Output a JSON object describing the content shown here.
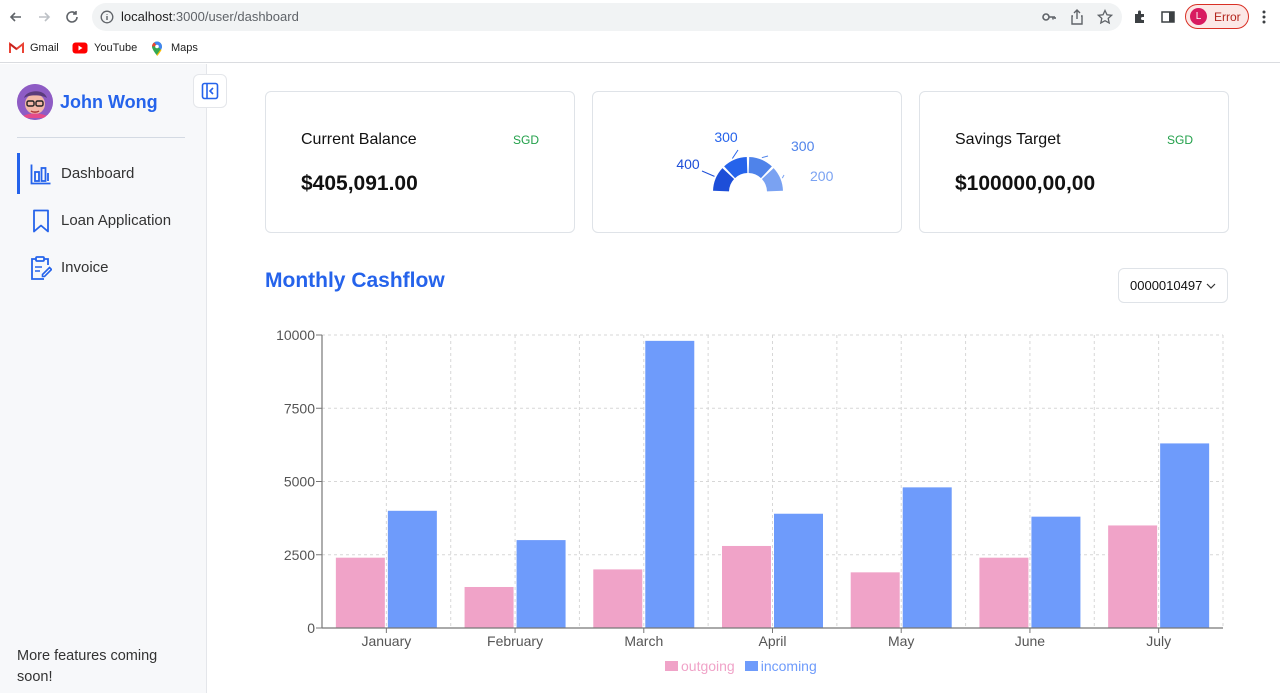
{
  "browser": {
    "url_host": "localhost",
    "url_path": ":3000/user/dashboard",
    "profile_initial": "L",
    "profile_status": "Error",
    "bookmarks": [
      {
        "label": "Gmail",
        "icon": "gmail-icon"
      },
      {
        "label": "YouTube",
        "icon": "youtube-icon"
      },
      {
        "label": "Maps",
        "icon": "maps-icon"
      }
    ]
  },
  "sidebar": {
    "user_name": "John Wong",
    "items": [
      {
        "label": "Dashboard",
        "icon": "bar-chart-icon",
        "active": true
      },
      {
        "label": "Loan Application",
        "icon": "bookmark-icon",
        "active": false
      },
      {
        "label": "Invoice",
        "icon": "clipboard-edit-icon",
        "active": false
      }
    ],
    "footer": "More features coming soon!"
  },
  "cards": {
    "balance": {
      "title": "Current Balance",
      "currency": "SGD",
      "value": "$405,091.00"
    },
    "savings": {
      "title": "Savings Target",
      "currency": "SGD",
      "value": "$100000,00,00"
    },
    "gauge": {
      "labels": [
        "400",
        "300",
        "300",
        "200"
      ],
      "colors": [
        "#1d4ed8",
        "#2563eb",
        "#4f83ea",
        "#7aa2f2"
      ]
    }
  },
  "cashflow": {
    "title": "Monthly Cashflow",
    "account": "0000010497"
  },
  "chart_data": {
    "type": "bar",
    "categories": [
      "January",
      "February",
      "March",
      "April",
      "May",
      "June",
      "July"
    ],
    "series": [
      {
        "name": "outgoing",
        "color": "#f0a3c8",
        "values": [
          2400,
          1400,
          2000,
          2800,
          1900,
          2400,
          3500
        ]
      },
      {
        "name": "incoming",
        "color": "#6e9bfb",
        "values": [
          4000,
          3000,
          9800,
          3900,
          4800,
          3800,
          6300
        ]
      }
    ],
    "yticks": [
      "0",
      "2500",
      "5000",
      "7500",
      "10000"
    ],
    "ylim": [
      0,
      10000
    ],
    "grid": true,
    "legend": "bottom-center"
  }
}
